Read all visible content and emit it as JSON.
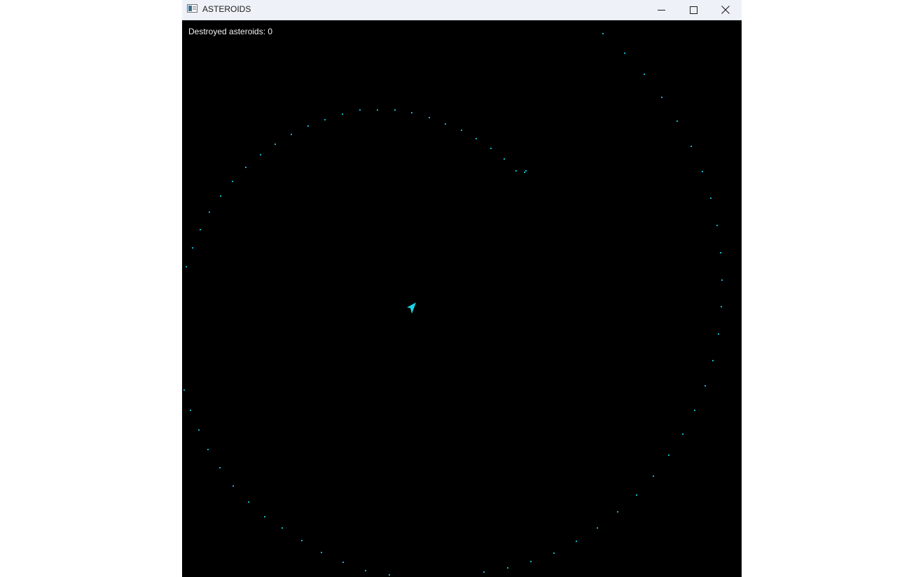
{
  "window": {
    "title": "ASTEROIDS"
  },
  "hud": {
    "score_label": "Destroyed asteroids:",
    "score_value": 0
  },
  "colors": {
    "background": "#000000",
    "ship": "#19d7e8",
    "projectile": "#11b3c9",
    "hud_text": "#f0f0f0"
  },
  "icons": {
    "app": "window-app-icon",
    "minimize": "minimize-icon",
    "maximize": "maximize-icon",
    "close": "close-icon",
    "ship": "ship-icon"
  }
}
